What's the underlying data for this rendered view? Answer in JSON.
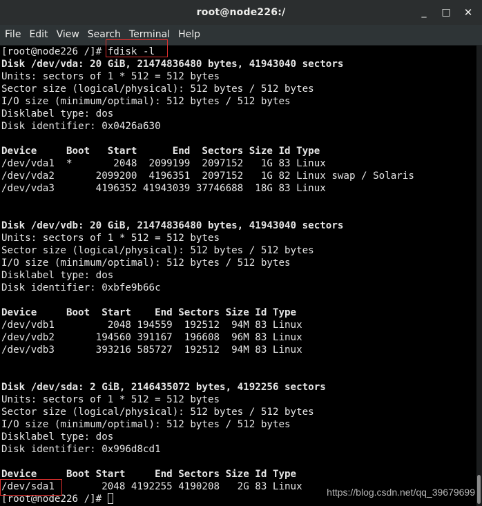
{
  "window": {
    "title": "root@node226:/",
    "minimize_glyph": "_",
    "maximize_glyph": "□",
    "close_glyph": "✕"
  },
  "menu": [
    "File",
    "Edit",
    "View",
    "Search",
    "Terminal",
    "Help"
  ],
  "terminal": {
    "lines": [
      {
        "text": "[root@node226 /]# fdisk -l",
        "bold": false
      },
      {
        "text": "Disk /dev/vda: 20 GiB, 21474836480 bytes, 41943040 sectors",
        "bold": true
      },
      {
        "text": "Units: sectors of 1 * 512 = 512 bytes",
        "bold": false
      },
      {
        "text": "Sector size (logical/physical): 512 bytes / 512 bytes",
        "bold": false
      },
      {
        "text": "I/O size (minimum/optimal): 512 bytes / 512 bytes",
        "bold": false
      },
      {
        "text": "Disklabel type: dos",
        "bold": false
      },
      {
        "text": "Disk identifier: 0x0426a630",
        "bold": false
      },
      {
        "text": "",
        "bold": false
      },
      {
        "text": "Device     Boot   Start      End  Sectors Size Id Type",
        "bold": true
      },
      {
        "text": "/dev/vda1  *       2048  2099199  2097152   1G 83 Linux",
        "bold": false
      },
      {
        "text": "/dev/vda2       2099200  4196351  2097152   1G 82 Linux swap / Solaris",
        "bold": false
      },
      {
        "text": "/dev/vda3       4196352 41943039 37746688  18G 83 Linux",
        "bold": false
      },
      {
        "text": "",
        "bold": false
      },
      {
        "text": "",
        "bold": false
      },
      {
        "text": "Disk /dev/vdb: 20 GiB, 21474836480 bytes, 41943040 sectors",
        "bold": true
      },
      {
        "text": "Units: sectors of 1 * 512 = 512 bytes",
        "bold": false
      },
      {
        "text": "Sector size (logical/physical): 512 bytes / 512 bytes",
        "bold": false
      },
      {
        "text": "I/O size (minimum/optimal): 512 bytes / 512 bytes",
        "bold": false
      },
      {
        "text": "Disklabel type: dos",
        "bold": false
      },
      {
        "text": "Disk identifier: 0xbfe9b66c",
        "bold": false
      },
      {
        "text": "",
        "bold": false
      },
      {
        "text": "Device     Boot  Start    End Sectors Size Id Type",
        "bold": true
      },
      {
        "text": "/dev/vdb1         2048 194559  192512  94M 83 Linux",
        "bold": false
      },
      {
        "text": "/dev/vdb2       194560 391167  196608  96M 83 Linux",
        "bold": false
      },
      {
        "text": "/dev/vdb3       393216 585727  192512  94M 83 Linux",
        "bold": false
      },
      {
        "text": "",
        "bold": false
      },
      {
        "text": "",
        "bold": false
      },
      {
        "text": "Disk /dev/sda: 2 GiB, 2146435072 bytes, 4192256 sectors",
        "bold": true
      },
      {
        "text": "Units: sectors of 1 * 512 = 512 bytes",
        "bold": false
      },
      {
        "text": "Sector size (logical/physical): 512 bytes / 512 bytes",
        "bold": false
      },
      {
        "text": "I/O size (minimum/optimal): 512 bytes / 512 bytes",
        "bold": false
      },
      {
        "text": "Disklabel type: dos",
        "bold": false
      },
      {
        "text": "Disk identifier: 0x996d8cd1",
        "bold": false
      },
      {
        "text": "",
        "bold": false
      },
      {
        "text": "Device     Boot Start     End Sectors Size Id Type",
        "bold": true
      },
      {
        "text": "/dev/sda1        2048 4192255 4190208   2G 83 Linux",
        "bold": false
      }
    ],
    "prompt": "[root@node226 /]# "
  },
  "watermark": "https://blog.csdn.net/qq_39679699",
  "colors": {
    "titlebar_bg": "#2b2e2f",
    "terminal_bg": "#000000",
    "terminal_fg": "#e6e6e6",
    "annotation": "#e0302f"
  }
}
